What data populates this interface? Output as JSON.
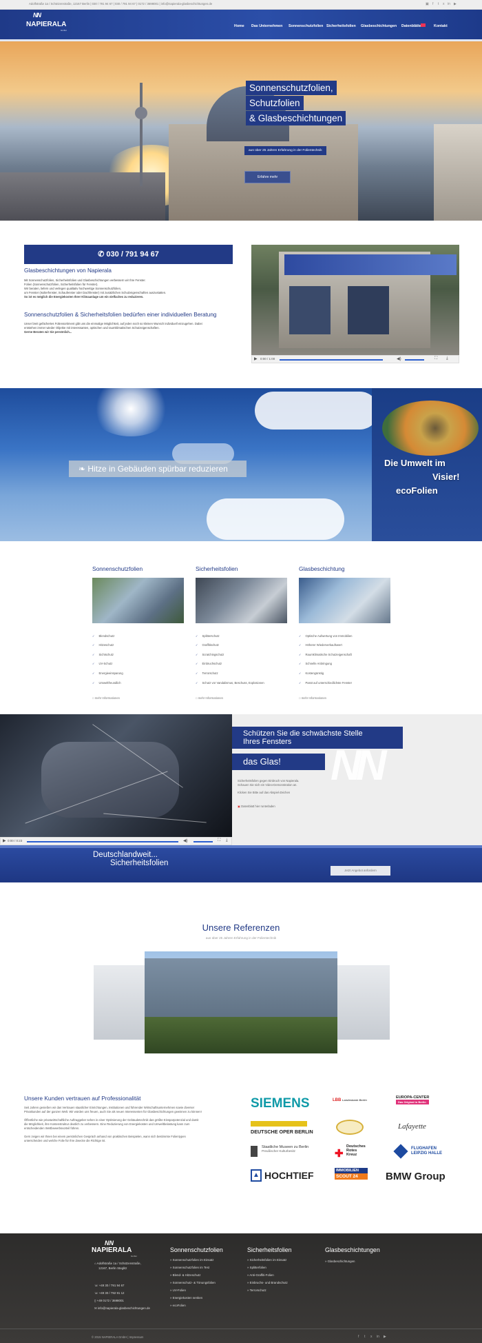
{
  "topbar": {
    "contact": "Adolfstraße 1a / Schützenstraße, 12167 Berlin  |  030 / 791 94 67  |  030 / 791 94 67  |  0172 / 3698001  |  info@napierala-glasbeschichtungen.de"
  },
  "header": {
    "logo_mark": "NN",
    "logo_text": "NAPIERALA",
    "logo_sub": "GmbH",
    "nav": [
      "Home",
      "Das Unternehmen",
      "Sonnenschutzfolien",
      "Sicherheitsfolien",
      "Glasbeschichtungen",
      "Datenblätter",
      "Kontakt"
    ]
  },
  "hero": {
    "line1": "Sonnenschutzfolien,",
    "line2": "Schutzfolien",
    "line3": "& Glasbeschichtungen",
    "subtitle": "aus über 25 Jahren Erfahrung in der Folientechnik",
    "button": "Erfahre mehr"
  },
  "intro": {
    "phone": "030 / 791 94 67",
    "heading": "Glasbeschichtungen von Napierala",
    "p1": "Mit Sonnenschutzfolien, Sicherheitsfolien und Glasbeschichtungen verbessern wir Ihre Fenster.",
    "p2": "Folien (Sonnenschutzfolien, Sicherheitsfolien für Fenster).",
    "p3": "Wir beraten, liefern und verlegen qualitativ hochwertige Sonnenschutzfolien,",
    "p4": "um Fenster (Isolierfenster, Schaufenster oder Dachfenster) mit zusätzlichen Schutzeigenschaften auszustatten.",
    "p5": "So ist es möglich die Energiekosten Ihrer Klimaanlage um ein vielfaches zu reduzieren.",
    "heading2": "Sonnenschutzfolien & Sicherheitsfolien bedürfen einer individuellen Beratung",
    "p6": "Unser breit gefächertes Foliensortiment gibt uns die einmalige Möglichkeit, auf jeden noch so kleinen Wunsch individuell einzugehen. Dabei",
    "p7": "entstehen immer wieder Objekte mit interessanten, optischen und raumklimatischen Schutzeigenschaften.",
    "p8": "Gerne Beraten wir Sie persönlich...",
    "video_time": "0:00 / 1:00"
  },
  "eco": {
    "button": "Hitze in Gebäuden spürbar reduzieren",
    "t1": "Die Umwelt im",
    "t2": "Visier!",
    "t3": "ecoFolien"
  },
  "products": [
    {
      "title": "Sonnenschutzfolien",
      "features": [
        "Blendschutz",
        "Hitzeschutz",
        "Sichtschutz",
        "UV-Schutz",
        "Energieeinsparung",
        "Umweltfreundlich"
      ],
      "more": "mehr Informationen"
    },
    {
      "title": "Sicherheitsfolien",
      "features": [
        "Splitterschutz",
        "Graffitischutz",
        "Scratchingschutz",
        "Einbruchschutz",
        "Terrorschutz",
        "Schutz vor Vandalismus, Beschuss, Explosionen"
      ],
      "more": "mehr Informationen"
    },
    {
      "title": "Glasbeschichtung",
      "features": [
        "Optische Aufwertung von Immobilien",
        "Höherer Wiederverkaufswert",
        "Raumklimatische Schutzeigenschaft",
        "Schnelle Anbringung",
        "Kostengünstig",
        "Passt auf unterschiedlichste Fenster"
      ],
      "more": "mehr Informationen"
    }
  ],
  "glass": {
    "t1a": "Schützen Sie die schwächste Stelle",
    "t1b": "Ihres Fensters",
    "t2": "das Glas!",
    "p1": "Sicherheitsfolien gegen Einbruch von Napierala.",
    "p2": "Schauen Sie sich ein Video-Demonstration an.",
    "p3": "Klicken Sie Bitte auf das Abspiel-Zeichen",
    "pdf": "Datenblatt hier runterladen",
    "video_time": "0:00 / 0:23"
  },
  "de": {
    "t1": "Deutschlandweit...",
    "t2": "Sicherheitsfolien",
    "button": "Jetzt Angebot anfordern"
  },
  "references": {
    "heading": "Unsere Referenzen",
    "sub": "aus über 25 Jahren Erfahrung in der Folientechnik"
  },
  "customers": {
    "heading": "Unsere Kunden vertrauen auf Professionalität",
    "p1": "Seit Jahren genießen wir das Vertrauen staatlicher Einrichtungen, Institutionen und führender Wirtschaftsunternehmen sowie diverser",
    "p2": "Privatkunden auf der ganzen Welt. Wir würden uns freuen, auch Sie als neuen Interessenten für Glasbeschichtungen gewinnen zu können!",
    "p3": "Öffentliche wie privatwirtschaftliche Auftraggeber sehen in einer Optimierung der Gebäudetechnik das größte Einsparpotenzial und damit",
    "p4": "die Möglichkeit, ihre Kostenstruktur deutlich zu verbessern. Eine Reduzierung von Energiekosten und Umweltbelastung kann zum",
    "p5": "entscheidenden Wettbewerbsvorteil führen.",
    "p6": "Gern zeigen wir Ihnen bei einem persönlichen Gespräch anhand von praktischen Beispielen, wann sich bestimmte Folientypen",
    "p7": "unterscheiden und welche Folie für Ihre Zwecke die Richtige ist.",
    "logos": {
      "siemens": "SIEMENS",
      "lbb1": "LBB",
      "lbb2": "Landesbank Berlin",
      "europa1": "EUROPA-CENTER",
      "europa2": "Das Original in Berlin",
      "oper": "DEUTSCHE OPER BERLIN",
      "lafayette": "Lafayette",
      "museen1": "Staatliche Museen zu Berlin",
      "museen2": "Preußischer Kulturbesitz",
      "drk1": "Deutsches",
      "drk2": "Rotes",
      "drk3": "Kreuz",
      "flughafen1": "FLUGHAFEN",
      "flughafen2": "LEIPZIG HALLE",
      "hochtief": "HOCHTIEF",
      "immo1": "IMMOBILIEN",
      "immo2": "SCOUT 24",
      "bmw": "BMW Group"
    }
  },
  "footer": {
    "logo": "NAPIERALA",
    "logo_sub": "GmbH",
    "address1": "Adolfstraße 1a / Schützenstraße,",
    "address2": "12167, Berlin Steglitz",
    "phone1": "+49 30 / 791 94 67",
    "phone2": "+49 30 / 792 91 12",
    "mobile": "+49 0172 / 3698001",
    "email": "info@napierala-glasbeschichtungen.de",
    "col1_title": "Sonnenschutzfolien",
    "col1": [
      "» Sonnenschutzfolien im Einsatz",
      "» Sonnenschutzfolien im Test",
      "» Blend- & Hitzeschutz",
      "» Sonnenschutz- & Tönungsfolien",
      "» UV-Folien",
      "» Energiekosten senken",
      "» ecoFolien"
    ],
    "col2_title": "Sicherheitsfolien",
    "col2": [
      "» Sicherheitsfolien im Einsatz",
      "» Splitterfolien",
      "» Anti-Graffiti-Folien",
      "» Einbruchs- und Brandschutz",
      "» Terrorschutz"
    ],
    "col3_title": "Glasbeschichtungen",
    "col3": [
      "» Glasbeschichtungen"
    ],
    "copyright": "© 2015 NAPIERALA GmbH | Impressum"
  }
}
